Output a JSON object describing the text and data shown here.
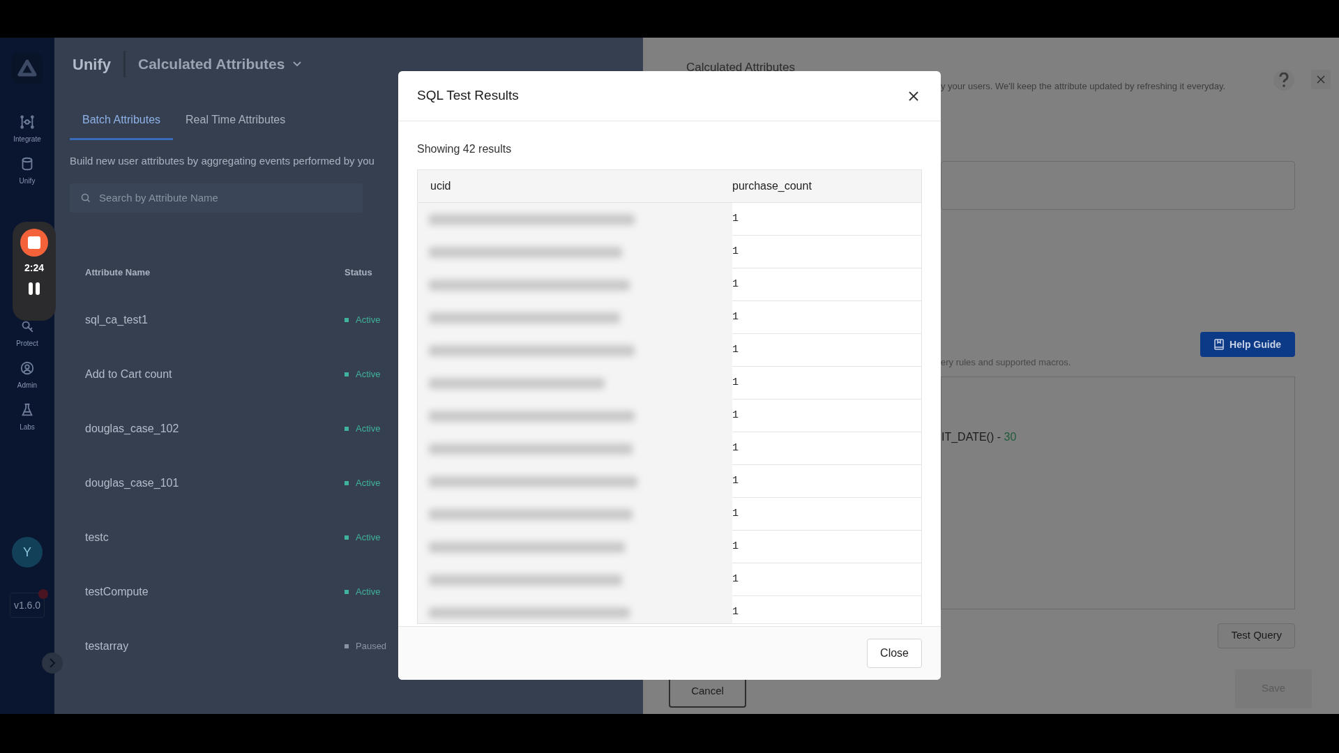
{
  "sidebar": {
    "items": [
      {
        "kind": "integrate",
        "label": "Integrate"
      },
      {
        "kind": "unify",
        "label": "Unify"
      },
      {
        "kind": "protect",
        "label": "Protect"
      },
      {
        "kind": "admin",
        "label": "Admin"
      },
      {
        "kind": "labs",
        "label": "Labs"
      }
    ],
    "avatar": "Y",
    "version": "v1.6.0"
  },
  "recorder": {
    "time": "2:24"
  },
  "header": {
    "app": "Unify",
    "section": "Calculated Attributes"
  },
  "tabs": [
    {
      "label": "Batch Attributes",
      "selected": true
    },
    {
      "label": "Real Time Attributes",
      "selected": false
    }
  ],
  "description": "Build new user attributes by aggregating events performed by you",
  "search": {
    "placeholder": "Search by Attribute Name"
  },
  "attributes": {
    "columns": [
      "Attribute Name",
      "Status"
    ],
    "rows": [
      {
        "name": "sql_ca_test1",
        "status": "Active",
        "active": true
      },
      {
        "name": "Add to Cart count",
        "status": "Active",
        "active": true
      },
      {
        "name": "douglas_case_102",
        "status": "Active",
        "active": true
      },
      {
        "name": "douglas_case_101",
        "status": "Active",
        "active": true
      },
      {
        "name": "testc",
        "status": "Active",
        "active": true
      },
      {
        "name": "testCompute",
        "status": "Active",
        "active": true
      },
      {
        "name": "testarray",
        "status": "Paused",
        "active": false
      }
    ]
  },
  "editor_panel": {
    "title": "Calculated Attributes",
    "description": "y your users. We'll keep the attribute updated by refreshing it everyday.",
    "help_guide": "Help Guide",
    "hint": "ery rules and supported macros.",
    "code": "IT_DATE() - ",
    "code_number": "30",
    "test_button": "Test Query",
    "cancel_button": "Cancel",
    "save_button": {
      "label": "Save",
      "disabled": true
    }
  },
  "dialog": {
    "title": "SQL Test Results",
    "summary": "Showing 42 results",
    "columns": [
      "ucid",
      "purchase_count"
    ],
    "rows": [
      {
        "purchase_count": "1"
      },
      {
        "purchase_count": "1"
      },
      {
        "purchase_count": "1"
      },
      {
        "purchase_count": "1"
      },
      {
        "purchase_count": "1"
      },
      {
        "purchase_count": "1"
      },
      {
        "purchase_count": "1"
      },
      {
        "purchase_count": "1"
      },
      {
        "purchase_count": "1"
      },
      {
        "purchase_count": "1"
      },
      {
        "purchase_count": "1"
      },
      {
        "purchase_count": "1"
      },
      {
        "purchase_count": "1"
      }
    ],
    "close_button": "Close"
  }
}
